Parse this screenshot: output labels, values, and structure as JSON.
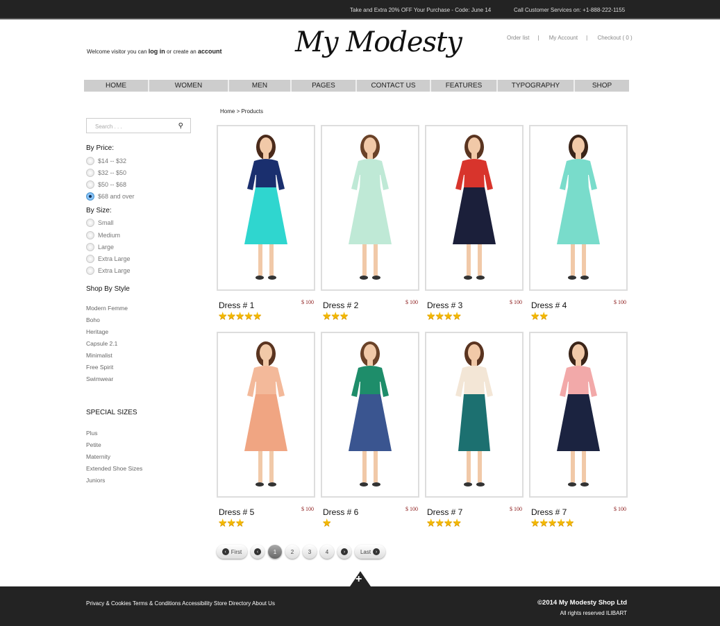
{
  "topbar": {
    "promo": "Take and Extra 20% OFF Your Purchase - Code: June 14",
    "phone": "Call Customer Services on: +1-888-222-1155"
  },
  "header": {
    "welcome_pre": "Welcome visitor you can",
    "login": "log in",
    "welcome_mid": "or create an",
    "account": "account",
    "logo": "My Modesty",
    "links": [
      "Order list",
      "My Account",
      "Checkout ( 0 )"
    ]
  },
  "nav": [
    "HOME",
    "WOMEN",
    "MEN",
    "PAGES",
    "CONTACT US",
    "FEATURES",
    "TYPOGRAPHY",
    "SHOP"
  ],
  "sidebar": {
    "search_placeholder": "Search . . .",
    "price_title": "By Price:",
    "prices": [
      "$14 -- $32",
      "$32 -- $50",
      "$50 -- $68",
      "$68 and over"
    ],
    "price_selected": 3,
    "size_title": "By Size:",
    "sizes": [
      "Small",
      "Medium",
      "Large",
      "Extra Large",
      "Extra Large"
    ],
    "style_title": "Shop By Style",
    "styles": [
      "Modern Femme",
      "Boho",
      "Heritage",
      "Capsule 2.1",
      "Minimalist",
      "Free Spirit",
      "Swimwear"
    ],
    "special_title": "SPECIAL SIZES",
    "special": [
      "Plus",
      "Petite",
      "Maternity",
      "Extended Shoe Sizes",
      "Juniors"
    ]
  },
  "breadcrumb": "Home > Products",
  "products": [
    {
      "name": "Dress # 1",
      "price": "$ 100",
      "rating": 5,
      "top": "#1a2f6e",
      "dress": "#2fd6cf",
      "hair": "#4a2a1a"
    },
    {
      "name": "Dress # 2",
      "price": "$ 100",
      "rating": 3,
      "top": "#bfe9d6",
      "dress": "#bfe9d6",
      "hair": "#6a4228"
    },
    {
      "name": "Dress # 3",
      "price": "$ 100",
      "rating": 4,
      "top": "#d8342c",
      "dress": "#1b1f3a",
      "hair": "#5a3420"
    },
    {
      "name": "Dress # 4",
      "price": "$ 100",
      "rating": 2,
      "top": "#79dccb",
      "dress": "#79dccb",
      "hair": "#3a2418"
    },
    {
      "name": "Dress # 5",
      "price": "$ 100",
      "rating": 3,
      "top": "#f3b99a",
      "dress": "#f0a582",
      "hair": "#5a3420"
    },
    {
      "name": "Dress # 6",
      "price": "$ 100",
      "rating": 1,
      "top": "#1e8d6a",
      "dress": "#3a5590",
      "hair": "#6a4228"
    },
    {
      "name": "Dress # 7",
      "price": "$ 100",
      "rating": 4,
      "top": "#f3e6d6",
      "dress": "#1c7070",
      "hair": "#5a3420"
    },
    {
      "name": "Dress # 7",
      "price": "$ 100",
      "rating": 5,
      "top": "#f2a9a9",
      "dress": "#1b2340",
      "hair": "#3a2418"
    }
  ],
  "pagination": {
    "first": "First",
    "pages": [
      "1",
      "2",
      "3",
      "4"
    ],
    "current": "1",
    "last": "Last"
  },
  "footer": {
    "links": "Privacy & Cookies Terms & Conditions Accessibility Store Directory About Us",
    "copyright": "©2014 My Modesty Shop Ltd",
    "rights": "All rights reserved  ILIBART"
  }
}
